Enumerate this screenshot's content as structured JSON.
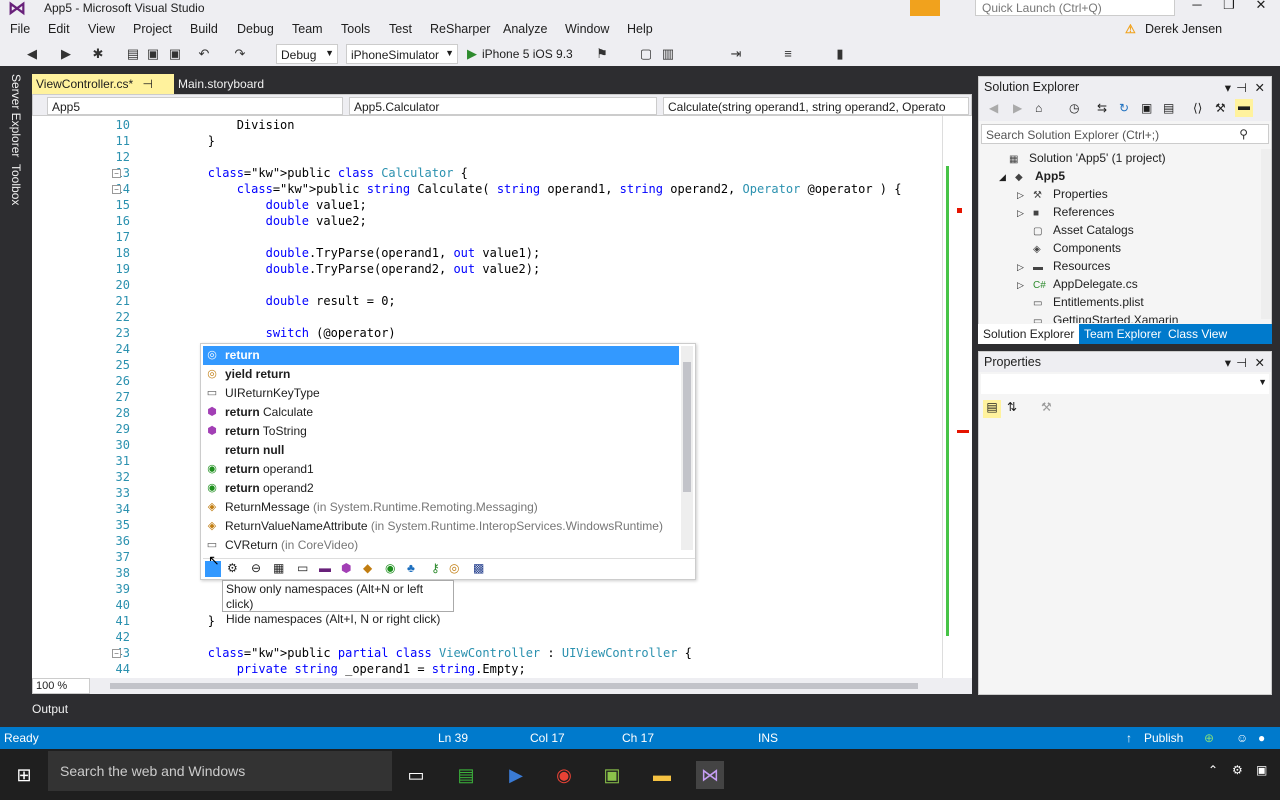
{
  "app": {
    "title": "App5 - Microsoft Visual Studio",
    "quick_launch": "Quick Launch (Ctrl+Q)",
    "user": "Derek Jensen"
  },
  "menu": [
    "File",
    "Edit",
    "View",
    "Project",
    "Build",
    "Debug",
    "Team",
    "Tools",
    "Test",
    "ReSharper",
    "Analyze",
    "Window",
    "Help"
  ],
  "toolbar": {
    "config": "Debug",
    "platform": "iPhoneSimulator",
    "device": "iPhone 5 iOS 9.3"
  },
  "sidebar": [
    "Server Explorer",
    "Toolbox"
  ],
  "tabs": [
    "ViewController.cs*",
    "Main.storyboard"
  ],
  "nav": {
    "project": "App5",
    "type": "App5.Calculator",
    "member": "Calculate(string operand1, string operand2, Operato"
  },
  "code": [
    {
      "n": "10",
      "t": "            Division"
    },
    {
      "n": "11",
      "t": "        }"
    },
    {
      "n": "12",
      "t": ""
    },
    {
      "n": "13",
      "t": "        public class Calculator {"
    },
    {
      "n": "14",
      "t": "            public string Calculate( string operand1, string operand2, Operator @operator ) {"
    },
    {
      "n": "15",
      "t": "                double value1;"
    },
    {
      "n": "16",
      "t": "                double value2;"
    },
    {
      "n": "17",
      "t": ""
    },
    {
      "n": "18",
      "t": "                double.TryParse(operand1, out value1);"
    },
    {
      "n": "19",
      "t": "                double.TryParse(operand2, out value2);"
    },
    {
      "n": "20",
      "t": ""
    },
    {
      "n": "21",
      "t": "                double result = 0;"
    },
    {
      "n": "22",
      "t": ""
    },
    {
      "n": "23",
      "t": "                switch (@operator)"
    },
    {
      "n": "24",
      "t": ""
    },
    {
      "n": "25",
      "t": ""
    },
    {
      "n": "26",
      "t": ""
    },
    {
      "n": "27",
      "t": ""
    },
    {
      "n": "28",
      "t": ""
    },
    {
      "n": "29",
      "t": ""
    },
    {
      "n": "30",
      "t": ""
    },
    {
      "n": "31",
      "t": ""
    },
    {
      "n": "32",
      "t": ""
    },
    {
      "n": "33",
      "t": ""
    },
    {
      "n": "34",
      "t": ""
    },
    {
      "n": "35",
      "t": ""
    },
    {
      "n": "36",
      "t": ""
    },
    {
      "n": "37",
      "t": ""
    },
    {
      "n": "38",
      "t": ""
    },
    {
      "n": "39",
      "t": "                re"
    },
    {
      "n": "40",
      "t": "            }"
    },
    {
      "n": "41",
      "t": "        }"
    },
    {
      "n": "42",
      "t": ""
    },
    {
      "n": "43",
      "t": "        public partial class ViewController : UIViewController {"
    },
    {
      "n": "44",
      "t": "            private string _operand1 = string.Empty;"
    }
  ],
  "autocomplete": [
    {
      "icon": "◎",
      "bold": "return",
      "rest": "",
      "ns": ""
    },
    {
      "icon": "◎",
      "bold": "yield return",
      "rest": "",
      "ns": ""
    },
    {
      "icon": "▭",
      "bold": "",
      "rest": "UIReturnKeyType",
      "ns": ""
    },
    {
      "icon": "⬢",
      "bold": "return",
      "rest": " Calculate",
      "ns": ""
    },
    {
      "icon": "⬢",
      "bold": "return",
      "rest": " ToString",
      "ns": ""
    },
    {
      "icon": "",
      "bold": "return null",
      "rest": "",
      "ns": ""
    },
    {
      "icon": "◉",
      "bold": "return",
      "rest": " operand1",
      "ns": ""
    },
    {
      "icon": "◉",
      "bold": "return",
      "rest": " operand2",
      "ns": ""
    },
    {
      "icon": "◈",
      "bold": "",
      "rest": "ReturnMessage",
      "ns": " (in System.Runtime.Remoting.Messaging)"
    },
    {
      "icon": "◈",
      "bold": "",
      "rest": "ReturnValueNameAttribute",
      "ns": " (in System.Runtime.InteropServices.WindowsRuntime)"
    },
    {
      "icon": "▭",
      "bold": "",
      "rest": "CVReturn",
      "ns": " (in CoreVideo)"
    }
  ],
  "tooltip": [
    "Show only namespaces (Alt+N or left click)",
    "Hide namespaces (Alt+I, N or right click)"
  ],
  "zoom": "100 %",
  "solution_explorer": {
    "title": "Solution Explorer",
    "search": "Search Solution Explorer (Ctrl+;)",
    "items": [
      "Solution 'App5' (1 project)",
      "App5",
      "Properties",
      "References",
      "Asset Catalogs",
      "Components",
      "Resources",
      "AppDelegate.cs",
      "Entitlements.plist",
      "GettingStarted.Xamarin"
    ],
    "tabs": [
      "Solution Explorer",
      "Team Explorer",
      "Class View"
    ]
  },
  "properties": {
    "title": "Properties"
  },
  "output": "Output",
  "status": {
    "ready": "Ready",
    "ln": "Ln 39",
    "col": "Col 17",
    "ch": "Ch 17",
    "ins": "INS",
    "publish": "Publish"
  },
  "taskbar": {
    "search": "Search the web and Windows"
  }
}
